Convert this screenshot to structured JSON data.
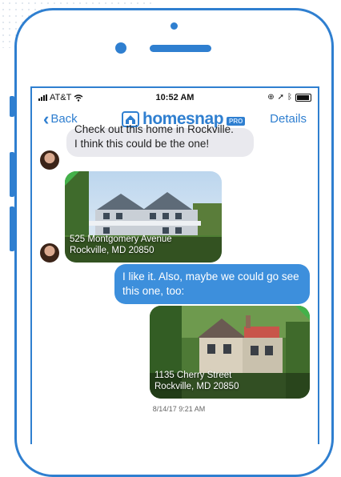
{
  "status_bar": {
    "carrier": "AT&T",
    "time": "10:52 AM"
  },
  "nav": {
    "back_label": "Back",
    "brand": "homesnap",
    "brand_badge": "PRO",
    "details_label": "Details"
  },
  "messages": [
    {
      "direction": "incoming",
      "lines": [
        "Check out this home in Rockville.",
        "I think this could be the one!"
      ]
    },
    {
      "direction": "incoming",
      "type": "listing",
      "address_line1": "525 Montgomery Avenue",
      "address_line2": "Rockville, MD 20850"
    },
    {
      "direction": "outgoing",
      "text": "I like it. Also, maybe we could go see this one, too:"
    },
    {
      "direction": "outgoing",
      "type": "listing",
      "address_line1": "1135 Cherry Street",
      "address_line2": "Rockville, MD 20850"
    }
  ],
  "timestamp": "8/14/17 9:21 AM",
  "colors": {
    "brand_blue": "#2f7fd0",
    "outgoing_bubble": "#3d8fdc",
    "incoming_bubble": "#e9e9ee",
    "listing_accent": "#44b14a"
  }
}
